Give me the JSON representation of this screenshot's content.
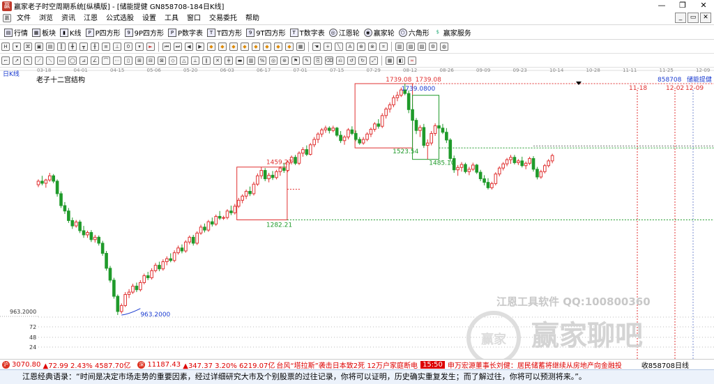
{
  "window": {
    "title": "赢家老子时空周期系统[纵横版] - [储能提健  GN858708-184日K线]",
    "app_icon": "赢"
  },
  "menu": {
    "items": [
      "文件",
      "浏览",
      "资讯",
      "江恩",
      "公式选股",
      "设置",
      "工具",
      "窗口",
      "交易委托",
      "帮助"
    ]
  },
  "toolbar1": {
    "items": [
      "行情",
      "板块",
      "K线",
      "P四方形",
      "9P四方形",
      "P数字表",
      "T四方形",
      "9T四方形",
      "T数字表",
      "江恩轮",
      "赢家轮",
      "六角形",
      "赢家服务"
    ]
  },
  "chart": {
    "period_label": "日K线",
    "study_title": "老子十二宫结构",
    "stock_code": "858708",
    "stock_name": "储能提健",
    "date_ticks": [
      "03-18",
      "04-01",
      "04-15",
      "05-06",
      "05-20",
      "06-03",
      "06-17",
      "07-01",
      "07-15",
      "07-29",
      "08-12",
      "08-26",
      "09-09",
      "09-23",
      "10-14",
      "10-28",
      "11-11",
      "11-25",
      "12-09",
      "12-23"
    ],
    "y_ticks": [
      "72",
      "48",
      "24"
    ],
    "price_label_left": "963.2000",
    "annotations": {
      "low": "963.2000",
      "box1_top": "1459.27",
      "box1_bottom": "1282.21",
      "peak_a": "1739.08",
      "peak_b": "1739.08",
      "peak_blue": "1739.0800",
      "box2_bottom": "1523.54",
      "box2_bottom2": "1485.10",
      "date_a": "11-18",
      "date_b": "12-02",
      "date_c": "12-09"
    },
    "watermark_software": "江恩工具软件  QQ:100800360",
    "watermark_brand": "赢家聊吧",
    "watermark_seal": "赢家"
  },
  "status": {
    "index1": "3070.80",
    "index1_change": "▲72.99 2.43% 4587.70亿",
    "index2": "11187.43",
    "index2_change": "▲347.37 3.20% 6219.07亿",
    "news1": "台风“塔拉斯”袭击日本致2死 12万户家庭断电",
    "time": "15:50",
    "news2": "申万宏源董事长刘健：居民储蓄将继续从房地产向金融投",
    "right": "收858708日线"
  },
  "quote": {
    "text": "江恩经典语录：“时间是决定市场走势的重要因素，经过详细研究大市及个别股票的过往记录，你将可以证明，历史确实重复发生；而了解过往，你将可以预测将来。”。"
  },
  "chart_data": {
    "type": "candlestick",
    "title": "老子十二宫结构",
    "colors": {
      "up": "#e03030",
      "down": "#1f9a2a",
      "box1": "#e03030",
      "box2_up": "#e03030",
      "box2_down": "#1f9a2a",
      "hline_red": "#e03030",
      "hline_green": "#1f9a2a"
    },
    "candles": [
      [
        1400,
        1418,
        1392,
        1412
      ],
      [
        1412,
        1430,
        1398,
        1405
      ],
      [
        1405,
        1420,
        1390,
        1416
      ],
      [
        1416,
        1440,
        1410,
        1430
      ],
      [
        1430,
        1436,
        1405,
        1412
      ],
      [
        1412,
        1418,
        1360,
        1370
      ],
      [
        1370,
        1378,
        1322,
        1330
      ],
      [
        1330,
        1342,
        1302,
        1312
      ],
      [
        1312,
        1322,
        1272,
        1280
      ],
      [
        1280,
        1290,
        1252,
        1262
      ],
      [
        1262,
        1282,
        1256,
        1275
      ],
      [
        1275,
        1282,
        1238,
        1246
      ],
      [
        1246,
        1262,
        1222,
        1232
      ],
      [
        1232,
        1246,
        1222,
        1240
      ],
      [
        1240,
        1248,
        1208,
        1216
      ],
      [
        1216,
        1232,
        1206,
        1224
      ],
      [
        1224,
        1230,
        1196,
        1204
      ],
      [
        1204,
        1212,
        1162,
        1170
      ],
      [
        1170,
        1178,
        1112,
        1120
      ],
      [
        1120,
        1128,
        1072,
        1080
      ],
      [
        1080,
        1088,
        1018,
        1026
      ],
      [
        1026,
        1032,
        963.2,
        975
      ],
      [
        975,
        1002,
        968,
        995
      ],
      [
        995,
        1040,
        990,
        1032
      ],
      [
        1032,
        1050,
        1020,
        1040
      ],
      [
        1040,
        1068,
        1034,
        1060
      ],
      [
        1060,
        1072,
        1040,
        1048
      ],
      [
        1048,
        1080,
        1042,
        1072
      ],
      [
        1072,
        1102,
        1066,
        1095
      ],
      [
        1095,
        1108,
        1080,
        1088
      ],
      [
        1088,
        1120,
        1082,
        1112
      ],
      [
        1112,
        1138,
        1106,
        1130
      ],
      [
        1130,
        1142,
        1110,
        1118
      ],
      [
        1118,
        1150,
        1112,
        1142
      ],
      [
        1142,
        1160,
        1130,
        1152
      ],
      [
        1152,
        1170,
        1140,
        1146
      ],
      [
        1146,
        1180,
        1140,
        1172
      ],
      [
        1172,
        1196,
        1166,
        1188
      ],
      [
        1188,
        1200,
        1170,
        1178
      ],
      [
        1178,
        1214,
        1172,
        1208
      ],
      [
        1208,
        1230,
        1200,
        1224
      ],
      [
        1224,
        1232,
        1196,
        1204
      ],
      [
        1204,
        1244,
        1198,
        1238
      ],
      [
        1238,
        1266,
        1232,
        1258
      ],
      [
        1258,
        1270,
        1240,
        1248
      ],
      [
        1248,
        1282,
        1242,
        1276
      ],
      [
        1276,
        1290,
        1260,
        1268
      ],
      [
        1268,
        1300,
        1262,
        1294
      ],
      [
        1294,
        1312,
        1282,
        1288
      ],
      [
        1288,
        1296,
        1282,
        1290
      ],
      [
        1290,
        1318,
        1284,
        1312
      ],
      [
        1312,
        1330,
        1298,
        1306
      ],
      [
        1306,
        1336,
        1300,
        1328
      ],
      [
        1328,
        1356,
        1322,
        1348
      ],
      [
        1348,
        1368,
        1338,
        1362
      ],
      [
        1362,
        1384,
        1352,
        1378
      ],
      [
        1378,
        1394,
        1362,
        1370
      ],
      [
        1370,
        1410,
        1364,
        1402
      ],
      [
        1402,
        1438,
        1396,
        1430
      ],
      [
        1430,
        1459.27,
        1420,
        1448
      ],
      [
        1448,
        1456,
        1412,
        1420
      ],
      [
        1420,
        1440,
        1408,
        1432
      ],
      [
        1432,
        1446,
        1416,
        1424
      ],
      [
        1424,
        1450,
        1418,
        1444
      ],
      [
        1444,
        1462,
        1430,
        1456
      ],
      [
        1456,
        1474,
        1440,
        1448
      ],
      [
        1448,
        1482,
        1442,
        1476
      ],
      [
        1476,
        1498,
        1468,
        1492
      ],
      [
        1492,
        1500,
        1466,
        1472
      ],
      [
        1472,
        1512,
        1466,
        1506
      ],
      [
        1506,
        1526,
        1494,
        1518
      ],
      [
        1518,
        1532,
        1496,
        1502
      ],
      [
        1502,
        1540,
        1498,
        1534
      ],
      [
        1534,
        1560,
        1526,
        1552
      ],
      [
        1552,
        1576,
        1540,
        1570
      ],
      [
        1570,
        1590,
        1560,
        1584
      ],
      [
        1584,
        1598,
        1574,
        1590
      ],
      [
        1590,
        1596,
        1572,
        1582
      ],
      [
        1582,
        1598,
        1576,
        1590
      ],
      [
        1590,
        1594,
        1560,
        1566
      ],
      [
        1566,
        1580,
        1540,
        1548
      ],
      [
        1548,
        1566,
        1534,
        1560
      ],
      [
        1560,
        1590,
        1552,
        1584
      ],
      [
        1584,
        1596,
        1566,
        1572
      ],
      [
        1572,
        1582,
        1546,
        1552
      ],
      [
        1552,
        1560,
        1534,
        1540
      ],
      [
        1540,
        1560,
        1534,
        1552
      ],
      [
        1552,
        1576,
        1546,
        1570
      ],
      [
        1570,
        1592,
        1560,
        1586
      ],
      [
        1586,
        1610,
        1578,
        1604
      ],
      [
        1604,
        1620,
        1588,
        1596
      ],
      [
        1596,
        1640,
        1590,
        1632
      ],
      [
        1632,
        1660,
        1622,
        1654
      ],
      [
        1654,
        1676,
        1642,
        1668
      ],
      [
        1668,
        1700,
        1660,
        1692
      ],
      [
        1692,
        1712,
        1680,
        1700
      ],
      [
        1700,
        1726,
        1694,
        1718
      ],
      [
        1718,
        1739.08,
        1700,
        1706
      ],
      [
        1706,
        1716,
        1640,
        1652
      ],
      [
        1652,
        1670,
        1600,
        1616
      ],
      [
        1616,
        1624,
        1570,
        1582
      ],
      [
        1582,
        1600,
        1560,
        1592
      ],
      [
        1592,
        1604,
        1523.54,
        1532
      ],
      [
        1532,
        1552,
        1485.1,
        1540
      ],
      [
        1540,
        1580,
        1532,
        1572
      ],
      [
        1572,
        1606,
        1564,
        1598
      ],
      [
        1598,
        1612,
        1584,
        1590
      ],
      [
        1590,
        1604,
        1570,
        1576
      ],
      [
        1576,
        1590,
        1540,
        1550
      ],
      [
        1550,
        1556,
        1478,
        1488
      ],
      [
        1488,
        1498,
        1440,
        1450
      ],
      [
        1450,
        1466,
        1430,
        1458
      ],
      [
        1458,
        1476,
        1444,
        1468
      ],
      [
        1468,
        1474,
        1438,
        1444
      ],
      [
        1444,
        1460,
        1432,
        1452
      ],
      [
        1452,
        1474,
        1446,
        1466
      ],
      [
        1466,
        1470,
        1436,
        1442
      ],
      [
        1442,
        1450,
        1412,
        1420
      ],
      [
        1420,
        1432,
        1398,
        1408
      ],
      [
        1408,
        1422,
        1384,
        1390
      ],
      [
        1390,
        1410,
        1384,
        1404
      ],
      [
        1404,
        1442,
        1398,
        1436
      ],
      [
        1436,
        1462,
        1428,
        1456
      ],
      [
        1456,
        1476,
        1448,
        1470
      ],
      [
        1470,
        1490,
        1462,
        1484
      ],
      [
        1484,
        1500,
        1470,
        1492
      ],
      [
        1492,
        1500,
        1468,
        1474
      ],
      [
        1474,
        1486,
        1466,
        1480
      ],
      [
        1480,
        1494,
        1458,
        1464
      ],
      [
        1464,
        1478,
        1452,
        1472
      ],
      [
        1472,
        1494,
        1466,
        1488
      ],
      [
        1488,
        1496,
        1444,
        1452
      ],
      [
        1452,
        1460,
        1418,
        1426
      ],
      [
        1426,
        1450,
        1420,
        1444
      ],
      [
        1444,
        1470,
        1438,
        1464
      ],
      [
        1464,
        1486,
        1458,
        1480
      ],
      [
        1480,
        1504,
        1472,
        1498
      ]
    ]
  }
}
